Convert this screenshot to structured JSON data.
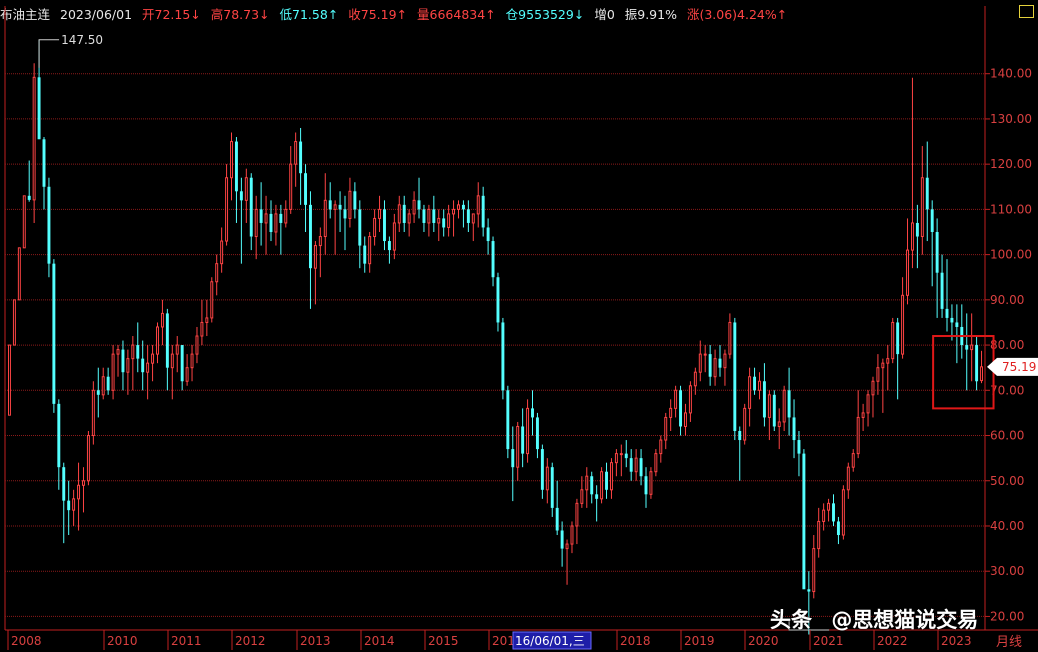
{
  "header": {
    "name": "布油主连",
    "date": "2023/06/01",
    "open": "开72.15↓",
    "high": "高78.73↓",
    "low": "低71.58↑",
    "close": "收75.19↑",
    "volume": "量6664834↑",
    "position": "仓9553529↓",
    "increase": "增0",
    "amplitude": "振9.91%",
    "change": "涨(3.06)4.24%↑"
  },
  "colors": {
    "up": "#ff4444",
    "down": "#54ffff",
    "grid": "#8b1a1a",
    "axis": "#c22020",
    "highlight": "#e01818",
    "label": "#d94040"
  },
  "chart_data": {
    "type": "candlestick",
    "period_label": "月线",
    "ylim": [
      17,
      149
    ],
    "y_ticks": [
      "20.00",
      "30.00",
      "40.00",
      "50.00",
      "60.00",
      "70.00",
      "80.00",
      "90.00",
      "100.00",
      "110.00",
      "120.00",
      "130.00",
      "140.00"
    ],
    "x_ticks": [
      "2008",
      "2010",
      "2011",
      "2012",
      "2013",
      "2014",
      "2015",
      "201",
      "2018",
      "2019",
      "2020",
      "2021",
      "2022",
      "2023"
    ],
    "cursor_label": "16/06/01,三",
    "max_label": "147.50",
    "min_label": "",
    "last_price": "75.19",
    "series": [
      [
        64.5,
        80.0,
        64.5,
        80.0
      ],
      [
        80.0,
        90.0,
        80.0,
        90.0
      ],
      [
        90.0,
        101.5,
        90.0,
        101.5
      ],
      [
        101.5,
        113.0,
        101.5,
        113.0
      ],
      [
        113.0,
        120.8,
        111.7,
        112.1
      ],
      [
        112.1,
        142.3,
        107.0,
        139.2
      ],
      [
        139.2,
        147.5,
        128.0,
        125.5
      ],
      [
        125.5,
        126.0,
        110.0,
        115.0
      ],
      [
        115.0,
        117.0,
        95.0,
        98.0
      ],
      [
        98.0,
        99.0,
        65.0,
        67.0
      ],
      [
        67.0,
        68.0,
        48.0,
        53.0
      ],
      [
        53.0,
        54.0,
        36.2,
        45.6
      ],
      [
        45.6,
        50.0,
        38.0,
        43.5
      ],
      [
        43.5,
        48.0,
        40.0,
        46.0
      ],
      [
        46.0,
        54.0,
        39.0,
        49.0
      ],
      [
        49.0,
        53.0,
        43.0,
        50.0
      ],
      [
        50.0,
        61.0,
        49.0,
        60.0
      ],
      [
        60.0,
        72.0,
        58.0,
        70.0
      ],
      [
        70.0,
        75.0,
        64.0,
        69.0
      ],
      [
        69.0,
        75.0,
        68.0,
        73.0
      ],
      [
        73.0,
        75.0,
        69.0,
        70.0
      ],
      [
        70.0,
        80.0,
        68.0,
        78.0
      ],
      [
        78.0,
        80.0,
        73.0,
        79.0
      ],
      [
        79.0,
        81.0,
        70.0,
        74.0
      ],
      [
        74.0,
        79.0,
        69.0,
        77.0
      ],
      [
        77.0,
        82.0,
        70.0,
        80.0
      ],
      [
        80.0,
        85.0,
        74.0,
        77.0
      ],
      [
        77.0,
        81.0,
        70.0,
        74.0
      ],
      [
        74.0,
        80.0,
        68.0,
        76.0
      ],
      [
        76.0,
        80.0,
        72.0,
        78.0
      ],
      [
        78.0,
        85.0,
        76.0,
        84.0
      ],
      [
        84.0,
        90.0,
        80.0,
        87.0
      ],
      [
        87.0,
        88.0,
        70.0,
        75.0
      ],
      [
        75.0,
        80.0,
        68.0,
        78.0
      ],
      [
        78.0,
        82.0,
        74.0,
        80.0
      ],
      [
        80.0,
        80.0,
        70.0,
        72.0
      ],
      [
        72.0,
        78.0,
        71.0,
        75.0
      ],
      [
        75.0,
        80.0,
        72.0,
        78.0
      ],
      [
        78.0,
        84.0,
        76.0,
        82.0
      ],
      [
        82.0,
        90.0,
        80.0,
        85.0
      ],
      [
        85.0,
        90.0,
        82.0,
        86.0
      ],
      [
        86.0,
        95.0,
        85.0,
        94.0
      ],
      [
        94.0,
        100.0,
        91.0,
        98.0
      ],
      [
        98.0,
        106.0,
        96.0,
        103.0
      ],
      [
        103.0,
        120.0,
        102.0,
        117.0
      ],
      [
        117.0,
        127.0,
        112.0,
        125.0
      ],
      [
        125.0,
        126.0,
        107.0,
        114.0
      ],
      [
        114.0,
        117.0,
        98.0,
        112.0
      ],
      [
        112.0,
        119.0,
        107.0,
        117.0
      ],
      [
        117.0,
        118.0,
        101.0,
        104.0
      ],
      [
        104.0,
        113.0,
        99.0,
        110.0
      ],
      [
        110.0,
        116.0,
        102.0,
        107.0
      ],
      [
        107.0,
        113.0,
        100.0,
        109.0
      ],
      [
        109.0,
        112.0,
        103.0,
        105.0
      ],
      [
        105.0,
        111.0,
        102.0,
        109.0
      ],
      [
        109.0,
        111.0,
        100.0,
        107.0
      ],
      [
        107.0,
        112.0,
        106.0,
        110.0
      ],
      [
        110.0,
        124.0,
        109.0,
        120.0
      ],
      [
        120.0,
        127.0,
        115.0,
        125.0
      ],
      [
        125.0,
        128.0,
        111.0,
        118.0
      ],
      [
        118.0,
        120.0,
        105.0,
        111.0
      ],
      [
        111.0,
        114.0,
        88.0,
        97.0
      ],
      [
        97.0,
        103.0,
        89.0,
        102.0
      ],
      [
        102.0,
        106.0,
        95.0,
        104.0
      ],
      [
        104.0,
        118.0,
        100.0,
        112.0
      ],
      [
        112.0,
        116.0,
        108.0,
        110.0
      ],
      [
        110.0,
        112.0,
        100.0,
        111.0
      ],
      [
        111.0,
        114.0,
        105.0,
        110.0
      ],
      [
        110.0,
        113.0,
        101.0,
        108.0
      ],
      [
        108.0,
        117.0,
        106.0,
        114.0
      ],
      [
        114.0,
        116.0,
        108.0,
        110.0
      ],
      [
        110.0,
        112.0,
        97.0,
        102.0
      ],
      [
        102.0,
        104.0,
        96.0,
        98.0
      ],
      [
        98.0,
        105.0,
        96.0,
        104.0
      ],
      [
        104.0,
        110.0,
        102.0,
        108.0
      ],
      [
        108.0,
        113.0,
        105.0,
        110.0
      ],
      [
        110.0,
        112.0,
        101.0,
        103.0
      ],
      [
        103.0,
        104.0,
        98.0,
        101.0
      ],
      [
        101.0,
        109.0,
        99.0,
        107.0
      ],
      [
        107.0,
        113.0,
        105.0,
        111.0
      ],
      [
        111.0,
        113.0,
        105.0,
        107.0
      ],
      [
        107.0,
        110.0,
        104.0,
        109.0
      ],
      [
        109.0,
        114.0,
        107.0,
        112.0
      ],
      [
        112.0,
        117.0,
        108.0,
        110.0
      ],
      [
        110.0,
        111.0,
        105.0,
        107.0
      ],
      [
        107.0,
        111.0,
        104.0,
        110.0
      ],
      [
        110.0,
        113.0,
        105.0,
        107.0
      ],
      [
        107.0,
        110.0,
        103.0,
        108.0
      ],
      [
        108.0,
        110.0,
        104.0,
        106.0
      ],
      [
        106.0,
        111.0,
        104.0,
        109.0
      ],
      [
        109.0,
        112.0,
        104.0,
        110.0
      ],
      [
        110.0,
        112.0,
        108.0,
        111.0
      ],
      [
        111.0,
        112.0,
        106.0,
        110.0
      ],
      [
        110.0,
        112.0,
        105.0,
        107.0
      ],
      [
        107.0,
        109.0,
        103.0,
        109.0
      ],
      [
        109.0,
        116.0,
        106.0,
        113.0
      ],
      [
        113.0,
        115.0,
        104.0,
        106.0
      ],
      [
        106.0,
        108.0,
        100.0,
        103.0
      ],
      [
        103.0,
        104.0,
        93.0,
        95.0
      ],
      [
        95.0,
        96.0,
        83.0,
        85.0
      ],
      [
        85.0,
        86.0,
        68.0,
        70.0
      ],
      [
        70.0,
        71.0,
        55.0,
        57.0
      ],
      [
        57.0,
        62.0,
        45.5,
        53.0
      ],
      [
        53.0,
        63.0,
        50.0,
        62.0
      ],
      [
        62.0,
        66.0,
        53.0,
        56.0
      ],
      [
        56.0,
        68.0,
        54.0,
        66.0
      ],
      [
        66.0,
        70.0,
        60.0,
        64.0
      ],
      [
        64.0,
        65.0,
        55.0,
        57.0
      ],
      [
        57.0,
        58.0,
        46.0,
        48.0
      ],
      [
        48.0,
        55.0,
        45.0,
        53.0
      ],
      [
        53.0,
        54.0,
        42.0,
        44.0
      ],
      [
        44.0,
        50.0,
        38.0,
        39.0
      ],
      [
        39.0,
        41.0,
        31.0,
        35.0
      ],
      [
        35.0,
        37.0,
        27.0,
        36.0
      ],
      [
        36.0,
        41.0,
        34.0,
        40.0
      ],
      [
        40.0,
        46.0,
        36.0,
        45.0
      ],
      [
        45.0,
        51.0,
        44.0,
        48.0
      ],
      [
        48.0,
        53.0,
        44.0,
        51.0
      ],
      [
        51.0,
        52.0,
        45.0,
        47.0
      ],
      [
        47.0,
        49.0,
        41.0,
        46.0
      ],
      [
        46.0,
        53.0,
        45.0,
        52.0
      ],
      [
        52.0,
        54.0,
        46.0,
        48.0
      ],
      [
        48.0,
        55.0,
        46.0,
        54.0
      ],
      [
        54.0,
        57.0,
        51.0,
        56.0
      ],
      [
        56.0,
        58.0,
        51.0,
        56.0
      ],
      [
        56.0,
        59.0,
        53.0,
        55.0
      ],
      [
        55.0,
        57.0,
        50.0,
        52.0
      ],
      [
        52.0,
        57.0,
        50.0,
        55.0
      ],
      [
        55.0,
        57.0,
        49.0,
        51.0
      ],
      [
        51.0,
        53.0,
        44.0,
        47.0
      ],
      [
        47.0,
        53.0,
        46.0,
        52.0
      ],
      [
        52.0,
        57.0,
        51.0,
        56.0
      ],
      [
        56.0,
        60.0,
        54.0,
        59.0
      ],
      [
        59.0,
        65.0,
        57.0,
        64.0
      ],
      [
        64.0,
        68.0,
        61.0,
        66.0
      ],
      [
        66.0,
        71.0,
        64.0,
        70.0
      ],
      [
        70.0,
        71.0,
        60.0,
        62.0
      ],
      [
        62.0,
        67.0,
        60.0,
        65.0
      ],
      [
        65.0,
        72.0,
        63.0,
        71.0
      ],
      [
        71.0,
        75.0,
        69.0,
        74.0
      ],
      [
        74.0,
        81.0,
        72.0,
        78.0
      ],
      [
        78.0,
        80.0,
        74.0,
        78.0
      ],
      [
        78.0,
        80.0,
        71.0,
        73.0
      ],
      [
        73.0,
        79.0,
        71.0,
        77.0
      ],
      [
        77.0,
        80.0,
        73.0,
        75.0
      ],
      [
        75.0,
        79.0,
        71.0,
        78.0
      ],
      [
        78.0,
        87.0,
        77.0,
        85.0
      ],
      [
        85.0,
        86.0,
        59.0,
        61.0
      ],
      [
        61.0,
        62.0,
        50.0,
        59.0
      ],
      [
        59.0,
        67.0,
        58.0,
        66.0
      ],
      [
        66.0,
        75.0,
        62.0,
        73.0
      ],
      [
        73.0,
        75.0,
        69.0,
        70.0
      ],
      [
        70.0,
        74.0,
        68.0,
        72.0
      ],
      [
        72.0,
        76.0,
        62.0,
        64.0
      ],
      [
        64.0,
        70.0,
        59.0,
        69.0
      ],
      [
        69.0,
        70.0,
        61.0,
        62.0
      ],
      [
        62.0,
        66.0,
        57.0,
        63.0
      ],
      [
        63.0,
        71.0,
        61.0,
        70.0
      ],
      [
        70.0,
        75.0,
        60.0,
        64.0
      ],
      [
        64.0,
        68.0,
        55.0,
        59.0
      ],
      [
        59.0,
        61.0,
        51.0,
        56.0
      ],
      [
        56.0,
        57.0,
        35.0,
        26.0
      ],
      [
        26.0,
        30.0,
        16.0,
        25.5
      ],
      [
        25.5,
        38.0,
        24.0,
        35.0
      ],
      [
        35.0,
        44.0,
        33.0,
        41.0
      ],
      [
        41.0,
        45.0,
        39.0,
        43.5
      ],
      [
        43.5,
        46.0,
        41.0,
        45.0
      ],
      [
        45.0,
        47.0,
        40.0,
        41.0
      ],
      [
        41.0,
        42.0,
        36.0,
        38.0
      ],
      [
        38.0,
        49.0,
        37.0,
        48.0
      ],
      [
        48.0,
        54.0,
        46.0,
        53.0
      ],
      [
        53.0,
        57.0,
        52.0,
        56.0
      ],
      [
        56.0,
        70.0,
        55.0,
        64.0
      ],
      [
        64.0,
        67.0,
        61.0,
        65.0
      ],
      [
        65.0,
        70.0,
        62.0,
        69.0
      ],
      [
        69.0,
        73.0,
        64.0,
        72.0
      ],
      [
        72.0,
        78.0,
        69.0,
        75.0
      ],
      [
        75.0,
        77.0,
        65.0,
        76.0
      ],
      [
        76.0,
        80.0,
        70.0,
        77.0
      ],
      [
        77.0,
        86.0,
        76.0,
        85.0
      ],
      [
        85.0,
        86.0,
        68.0,
        78.0
      ],
      [
        78.0,
        95.0,
        77.0,
        91.0
      ],
      [
        91.0,
        108.0,
        89.0,
        101.0
      ],
      [
        101.0,
        139.1,
        97.0,
        107.0
      ],
      [
        107.0,
        111.0,
        97.0,
        104.0
      ],
      [
        104.0,
        124.0,
        100.0,
        117.0
      ],
      [
        117.0,
        125.0,
        103.0,
        110.0
      ],
      [
        110.0,
        112.0,
        93.0,
        105.0
      ],
      [
        105.0,
        108.0,
        86.0,
        96.0
      ],
      [
        96.0,
        100.0,
        86.0,
        88.0
      ],
      [
        88.0,
        99.0,
        83.0,
        86.0
      ],
      [
        86.0,
        89.0,
        81.0,
        85.0
      ],
      [
        85.0,
        89.0,
        76.0,
        84.0
      ],
      [
        84.0,
        89.0,
        77.0,
        80.0
      ],
      [
        80.0,
        87.0,
        70.0,
        79.0
      ],
      [
        79.0,
        87.0,
        72.0,
        80.0
      ],
      [
        80.0,
        82.0,
        70.0,
        72.0
      ],
      [
        72.15,
        78.73,
        71.58,
        75.19
      ]
    ]
  },
  "watermark": {
    "brand": "头条",
    "author": "@思想猫说交易"
  }
}
